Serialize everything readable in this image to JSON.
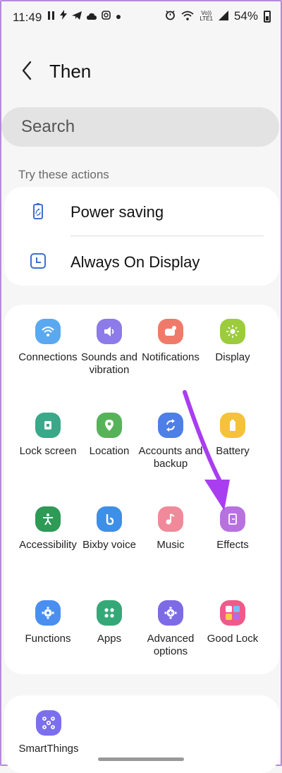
{
  "status_bar": {
    "time": "11:49",
    "left_icons": [
      "pause-icon",
      "bolt-icon",
      "telegram-icon",
      "cloud-icon",
      "instagram-icon",
      "dot-icon"
    ],
    "volte_top": "Vo))",
    "volte_bottom": "LTE1",
    "battery": "54%"
  },
  "header": {
    "title": "Then"
  },
  "search": {
    "placeholder": "Search"
  },
  "suggestions": {
    "heading": "Try these actions",
    "items": [
      {
        "label": "Power saving",
        "icon": "power-saving-icon"
      },
      {
        "label": "Always On Display",
        "icon": "clock-icon"
      }
    ]
  },
  "grid": [
    {
      "label": "Connections",
      "icon": "wifi-icon",
      "color": "#5aa9f0"
    },
    {
      "label": "Sounds and vibration",
      "icon": "volume-icon",
      "color": "#8c7be8"
    },
    {
      "label": "Notifications",
      "icon": "notification-icon",
      "color": "#f07a6a"
    },
    {
      "label": "Display",
      "icon": "sun-icon",
      "color": "#9ccc3c"
    },
    {
      "label": "Lock screen",
      "icon": "lock-icon",
      "color": "#3aa889"
    },
    {
      "label": "Location",
      "icon": "location-icon",
      "color": "#57b35a"
    },
    {
      "label": "Accounts and backup",
      "icon": "sync-icon",
      "color": "#4d7fe6"
    },
    {
      "label": "Battery",
      "icon": "battery-icon",
      "color": "#f5c23b"
    },
    {
      "label": "Accessibility",
      "icon": "accessibility-icon",
      "color": "#2e9a56"
    },
    {
      "label": "Bixby voice",
      "icon": "bixby-icon",
      "color": "#3d8fe8"
    },
    {
      "label": "Music",
      "icon": "music-icon",
      "color": "#f08a9a"
    },
    {
      "label": "Effects",
      "icon": "effects-icon",
      "color": "#b872e0"
    },
    {
      "label": "Functions",
      "icon": "gear-icon",
      "color": "#4a8ff0"
    },
    {
      "label": "Apps",
      "icon": "apps-icon",
      "color": "#35a878"
    },
    {
      "label": "Advanced options",
      "icon": "advanced-gear-icon",
      "color": "#7d6be6"
    },
    {
      "label": "Good Lock",
      "icon": "good-lock-icon",
      "color": "#f05a8a"
    }
  ],
  "bottom": {
    "label": "SmartThings",
    "icon": "smartthings-icon",
    "color": "#7b6ff0"
  },
  "annotation_color": "#a93df0"
}
